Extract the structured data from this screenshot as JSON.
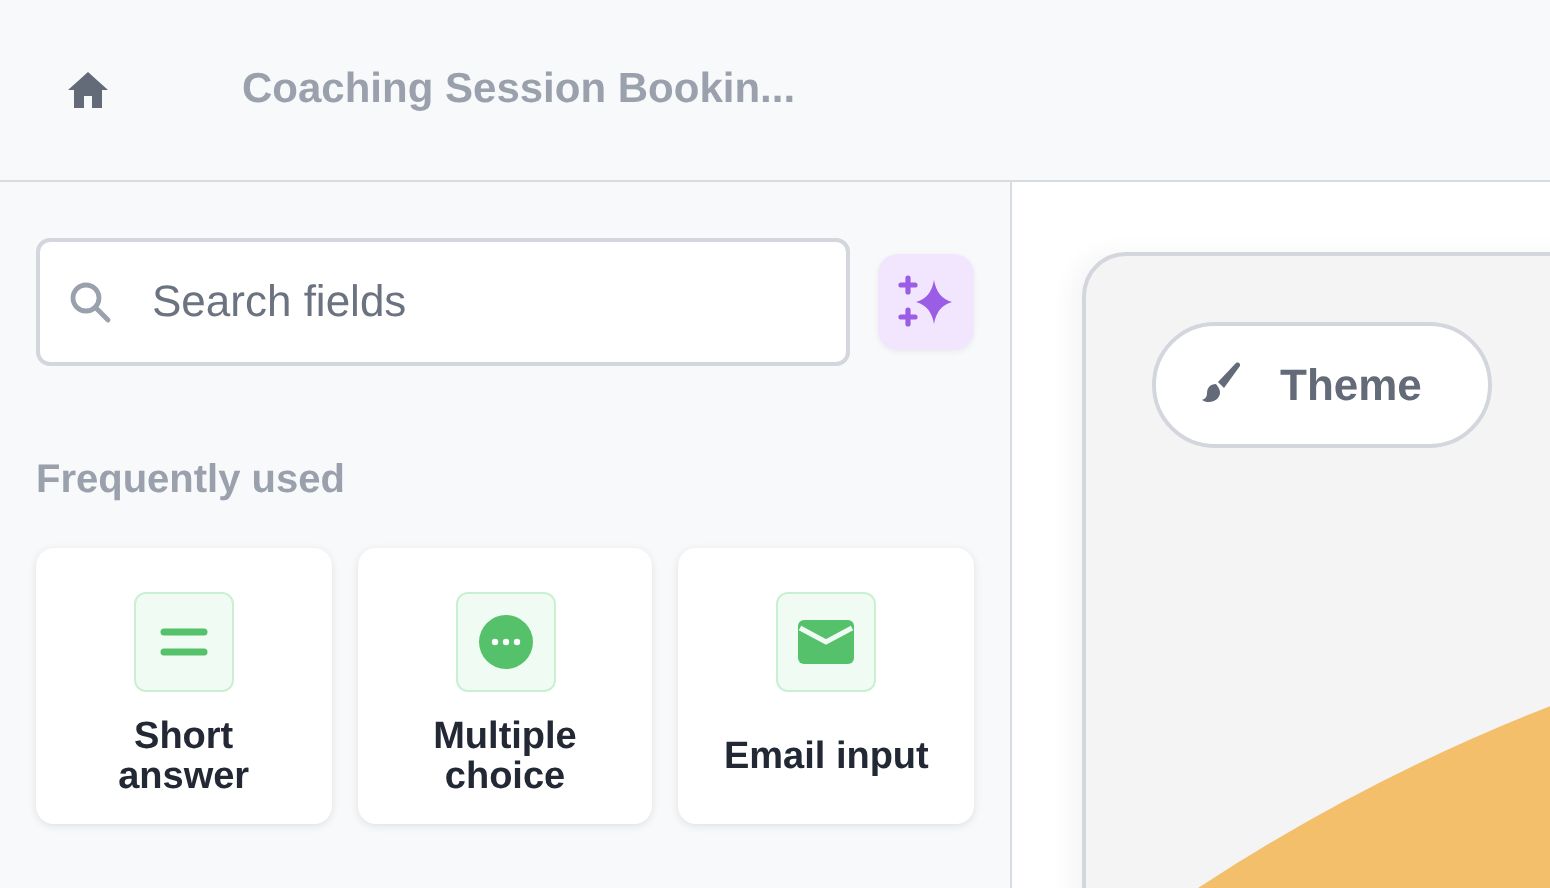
{
  "header": {
    "title": "Coaching Session Bookin..."
  },
  "sidebar": {
    "search": {
      "placeholder": "Search fields"
    },
    "section_title": "Frequently used",
    "fields": [
      {
        "kind": "short-answer",
        "label": "Short answer"
      },
      {
        "kind": "multiple-choice",
        "label": "Multiple choice"
      },
      {
        "kind": "email",
        "label": "Email input"
      }
    ]
  },
  "preview": {
    "theme_button": "Theme"
  }
}
